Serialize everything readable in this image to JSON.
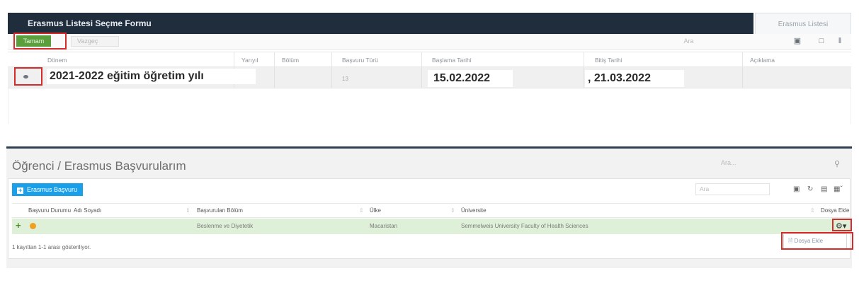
{
  "top_panel": {
    "title": "Erasmus Listesi Seçme Formu",
    "tab": "Erasmus Listesi",
    "buttons": {
      "tamam": "Tamam",
      "vazgec": "Vazgeç"
    },
    "search_placeholder": "Ara",
    "columns": [
      "Dönem",
      "Yarıyıl",
      "Bölüm",
      "Başvuru Türü",
      "Başlama Tarihi",
      "Bitiş Tarihi",
      "Açıklama"
    ],
    "row": {
      "donem": "2021-2022 eğitim öğretim yılı",
      "basvuru_turu": "13",
      "baslama_tarihi": "15.02.2022",
      "bitis_tarihi": ", 21.03.2022"
    },
    "toolbar_icons": [
      "print-icon",
      "refresh-icon",
      "columns-icon"
    ]
  },
  "bottom_panel": {
    "page_title": "Öğrenci / Erasmus Başvurularım",
    "page_search_placeholder": "Ara...",
    "new_button": "Erasmus Başvuru",
    "search_placeholder": "Ara",
    "columns": [
      "Başvuru Durumu",
      "Adı Soyadı",
      "Başvurulan Bölüm",
      "Ülke",
      "Üniversite",
      "Dosya Ekle"
    ],
    "row": {
      "bolum": "Beslenme ve Diyetetik",
      "ulke": "Macaristan",
      "universite": "Semmelweis University Faculty of Health Sciences"
    },
    "dropdown_item": "Dosya Ekle",
    "footer": "1 kayıttan 1-1 arası gösteriliyor."
  },
  "colors": {
    "header_dark": "#1f2d3d",
    "tamam_green": "#5a9f3c",
    "highlight_red": "#d62b2b",
    "primary_blue": "#1aa0e8",
    "row_green": "#dff0d8",
    "status_orange": "#f0a020"
  }
}
